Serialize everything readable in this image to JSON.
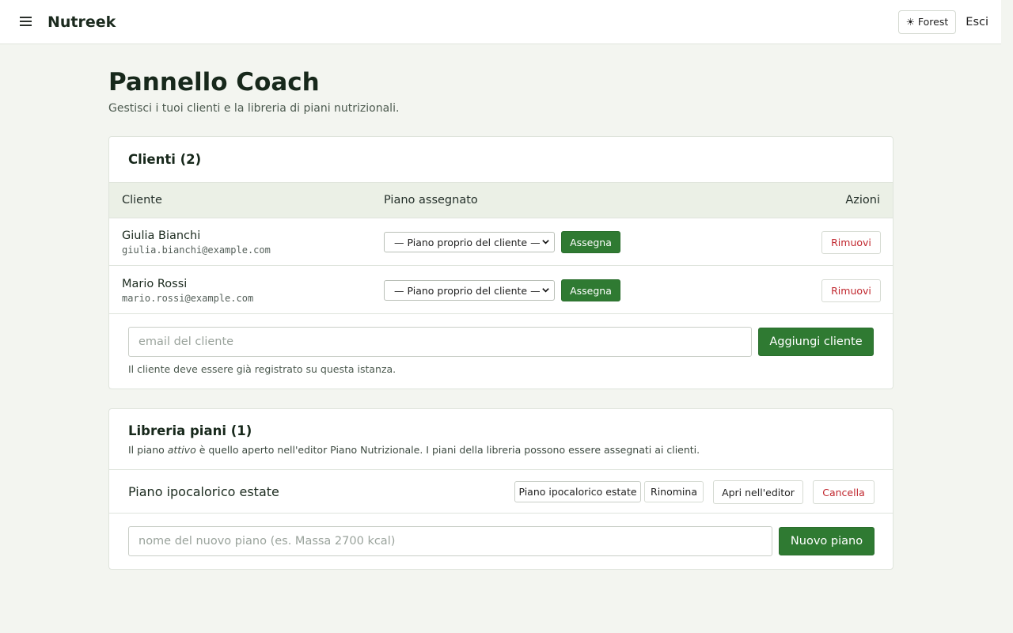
{
  "header": {
    "brand": "Nutreek",
    "theme_label": "Forest",
    "logout_label": "Esci"
  },
  "page": {
    "title": "Pannello Coach",
    "subtitle": "Gestisci i tuoi clienti e la libreria di piani nutrizionali."
  },
  "clients": {
    "title": "Clienti (2)",
    "columns": [
      "Cliente",
      "Piano assegnato",
      "Azioni"
    ],
    "rows": [
      {
        "name": "Giulia Bianchi",
        "email": "giulia.bianchi@example.com",
        "plan_selected": "— Piano proprio del cliente —",
        "assign_label": "Assegna",
        "remove_label": "Rimuovi"
      },
      {
        "name": "Mario Rossi",
        "email": "mario.rossi@example.com",
        "plan_selected": "— Piano proprio del cliente —",
        "assign_label": "Assegna",
        "remove_label": "Rimuovi"
      }
    ],
    "email_placeholder": "email del cliente",
    "add_label": "Aggiungi cliente",
    "hint": "Il cliente deve essere già registrato su questa istanza."
  },
  "library": {
    "title": "Libreria piani (1)",
    "desc_before": "Il piano ",
    "desc_em": "attivo",
    "desc_after": " è quello aperto nell'editor Piano Nutrizionale. I piani della libreria possono essere assegnati ai clienti.",
    "plans": [
      {
        "name": "Piano ipocalorico estate",
        "rename_value": "Piano ipocalorico estate",
        "rename_label": "Rinomina",
        "open_label": "Apri nell'editor",
        "delete_label": "Cancella"
      }
    ],
    "new_placeholder": "nome del nuovo piano (es. Massa 2700 kcal)",
    "new_label": "Nuovo piano"
  },
  "colors": {
    "accent_green": "#2f7a32",
    "danger_red": "#c0262d",
    "background": "#f3f5f0"
  },
  "icons": {
    "menu": "menu-icon",
    "theme": "sun-icon",
    "select": "chevron-down-icon"
  }
}
